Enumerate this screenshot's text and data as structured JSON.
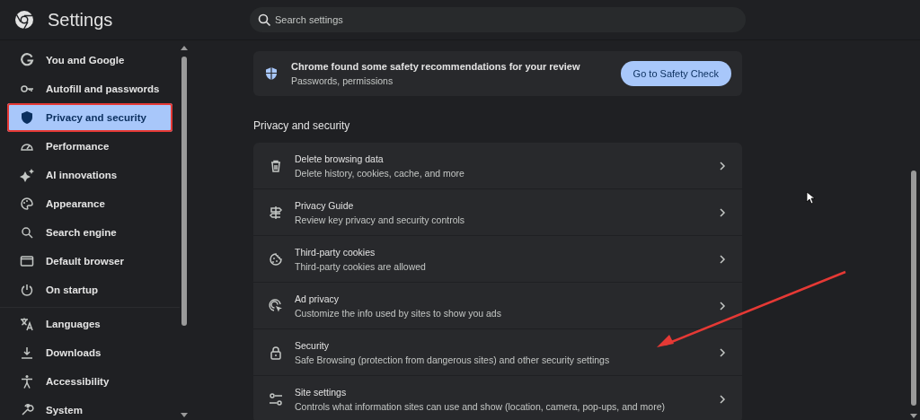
{
  "header": {
    "title": "Settings",
    "search": {
      "placeholder": "Search settings"
    }
  },
  "sidebar": {
    "items": [
      {
        "label": "You and Google",
        "selected": false,
        "highlighted": false
      },
      {
        "label": "Autofill and passwords",
        "selected": false,
        "highlighted": false
      },
      {
        "label": "Privacy and security",
        "selected": true,
        "highlighted": true
      },
      {
        "label": "Performance",
        "selected": false,
        "highlighted": false
      },
      {
        "label": "AI innovations",
        "selected": false,
        "highlighted": false
      },
      {
        "label": "Appearance",
        "selected": false,
        "highlighted": false
      },
      {
        "label": "Search engine",
        "selected": false,
        "highlighted": false
      },
      {
        "label": "Default browser",
        "selected": false,
        "highlighted": false
      },
      {
        "label": "On startup",
        "selected": false,
        "highlighted": false
      }
    ],
    "more_items": [
      {
        "label": "Languages",
        "selected": false,
        "highlighted": false
      },
      {
        "label": "Downloads",
        "selected": false,
        "highlighted": false
      },
      {
        "label": "Accessibility",
        "selected": false,
        "highlighted": false
      },
      {
        "label": "System",
        "selected": false,
        "highlighted": false
      }
    ]
  },
  "safety_card": {
    "title": "Chrome found some safety recommendations for your review",
    "subtitle": "Passwords, permissions",
    "button": "Go to Safety Check"
  },
  "section": {
    "heading": "Privacy and security",
    "rows": [
      {
        "title": "Delete browsing data",
        "subtitle": "Delete history, cookies, cache, and more"
      },
      {
        "title": "Privacy Guide",
        "subtitle": "Review key privacy and security controls"
      },
      {
        "title": "Third-party cookies",
        "subtitle": "Third-party cookies are allowed"
      },
      {
        "title": "Ad privacy",
        "subtitle": "Customize the info used by sites to show you ads"
      },
      {
        "title": "Security",
        "subtitle": "Safe Browsing (protection from dangerous sites) and other security settings"
      },
      {
        "title": "Site settings",
        "subtitle": "Controls what information sites can use and show (location, camera, pop-ups, and more)"
      }
    ]
  }
}
